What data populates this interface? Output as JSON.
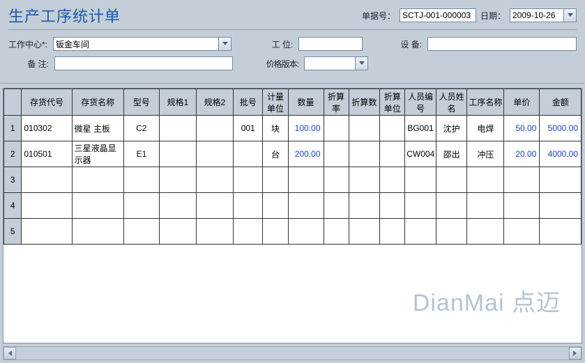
{
  "title": "生产工序统计单",
  "header": {
    "doc_no_label": "单据号：",
    "doc_no": "SCTJ-001-000003",
    "date_label": "日期：",
    "date": "2009-10-26"
  },
  "form": {
    "work_center_label": "工作中心*:",
    "work_center": "钣金车间",
    "position_label": "工 位:",
    "position": "",
    "device_label": "设 备:",
    "device": "",
    "remark_label": "备 注:",
    "remark": "",
    "price_ver_label": "价格版本:",
    "price_ver": ""
  },
  "columns": [
    "存货代号",
    "存货名称",
    "型号",
    "规格1",
    "规格2",
    "批号",
    "计量单位",
    "数量",
    "折算率",
    "折算数",
    "折算单位",
    "人员编号",
    "人员姓名",
    "工序名称",
    "单价",
    "金额"
  ],
  "rows": [
    {
      "n": "1",
      "code": "010302",
      "name": "微星 主板",
      "model": "C2",
      "spec1": "",
      "spec2": "",
      "batch": "001",
      "unit": "块",
      "qty": "100.00",
      "crate": "",
      "cqty": "",
      "cunit": "",
      "pno": "BG001",
      "pname": "沈护",
      "proc": "电焊",
      "price": "50.00",
      "amt": "5000.00"
    },
    {
      "n": "2",
      "code": "010501",
      "name": "三星液晶显示器",
      "model": "E1",
      "spec1": "",
      "spec2": "",
      "batch": "",
      "unit": "台",
      "qty": "200.00",
      "crate": "",
      "cqty": "",
      "cunit": "",
      "pno": "CW004",
      "pname": "邵出",
      "proc": "冲压",
      "price": "20.00",
      "amt": "4000.00"
    },
    {
      "n": "3",
      "code": "",
      "name": "",
      "model": "",
      "spec1": "",
      "spec2": "",
      "batch": "",
      "unit": "",
      "qty": "",
      "crate": "",
      "cqty": "",
      "cunit": "",
      "pno": "",
      "pname": "",
      "proc": "",
      "price": "",
      "amt": ""
    },
    {
      "n": "4",
      "code": "",
      "name": "",
      "model": "",
      "spec1": "",
      "spec2": "",
      "batch": "",
      "unit": "",
      "qty": "",
      "crate": "",
      "cqty": "",
      "cunit": "",
      "pno": "",
      "pname": "",
      "proc": "",
      "price": "",
      "amt": ""
    },
    {
      "n": "5",
      "code": "",
      "name": "",
      "model": "",
      "spec1": "",
      "spec2": "",
      "batch": "",
      "unit": "",
      "qty": "",
      "crate": "",
      "cqty": "",
      "cunit": "",
      "pno": "",
      "pname": "",
      "proc": "",
      "price": "",
      "amt": ""
    }
  ],
  "watermark": "DianMai 点迈"
}
